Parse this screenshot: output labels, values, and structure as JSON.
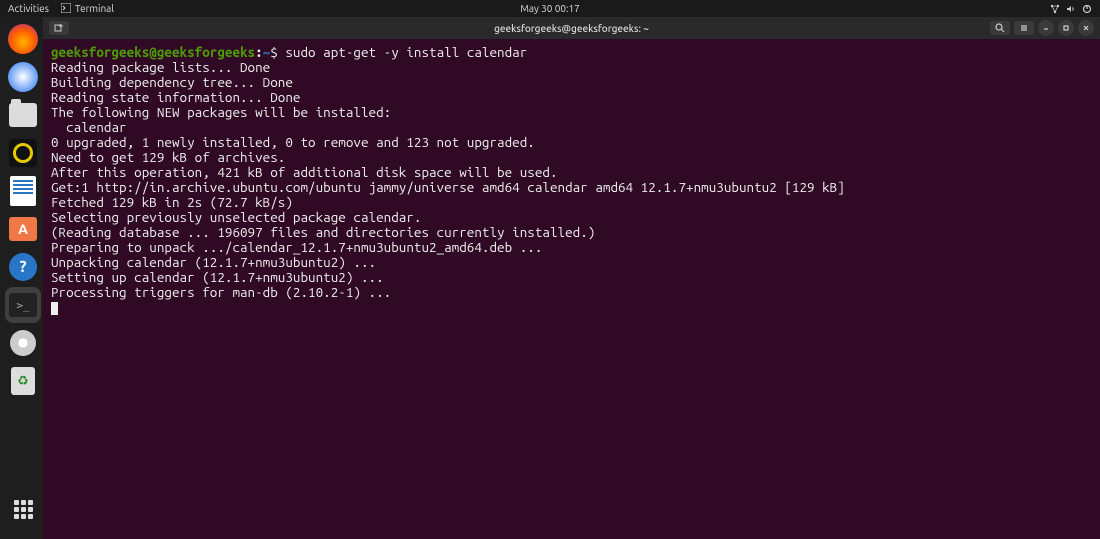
{
  "topbar": {
    "activities": "Activities",
    "app_name": "Terminal",
    "clock": "May 30  00:17"
  },
  "dock": {
    "items": [
      {
        "name": "firefox"
      },
      {
        "name": "thunderbird"
      },
      {
        "name": "files"
      },
      {
        "name": "rhythmbox"
      },
      {
        "name": "libreoffice-writer"
      },
      {
        "name": "ubuntu-software"
      },
      {
        "name": "help"
      },
      {
        "name": "terminal"
      },
      {
        "name": "disk"
      },
      {
        "name": "trash"
      }
    ]
  },
  "window": {
    "title": "geeksforgeeks@geeksforgeeks: ~"
  },
  "terminal": {
    "prompt_user_host": "geeksforgeeks@geeksforgeeks",
    "prompt_sep": ":",
    "prompt_path": "~",
    "prompt_symbol": "$",
    "command": "sudo apt-get -y install calendar",
    "output": [
      "Reading package lists... Done",
      "Building dependency tree... Done",
      "Reading state information... Done",
      "The following NEW packages will be installed:",
      "  calendar",
      "0 upgraded, 1 newly installed, 0 to remove and 123 not upgraded.",
      "Need to get 129 kB of archives.",
      "After this operation, 421 kB of additional disk space will be used.",
      "Get:1 http://in.archive.ubuntu.com/ubuntu jammy/universe amd64 calendar amd64 12.1.7+nmu3ubuntu2 [129 kB]",
      "Fetched 129 kB in 2s (72.7 kB/s)",
      "Selecting previously unselected package calendar.",
      "(Reading database ... 196097 files and directories currently installed.)",
      "Preparing to unpack .../calendar_12.1.7+nmu3ubuntu2_amd64.deb ...",
      "Unpacking calendar (12.1.7+nmu3ubuntu2) ...",
      "Setting up calendar (12.1.7+nmu3ubuntu2) ...",
      "Processing triggers for man-db (2.10.2-1) ..."
    ]
  }
}
